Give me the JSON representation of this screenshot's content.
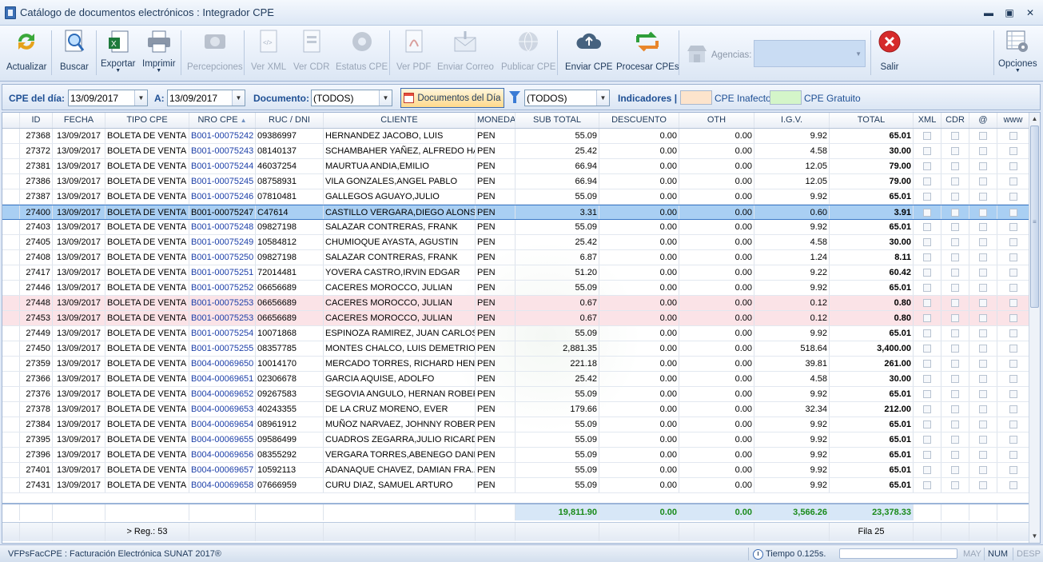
{
  "window": {
    "title": "Catálogo de documentos electrónicos : Integrador CPE"
  },
  "toolbar": {
    "actualizar": "Actualizar",
    "buscar": "Buscar",
    "exportar": "Exportar",
    "imprimir": "Imprimir",
    "percepciones": "Percepciones",
    "ver_xml": "Ver XML",
    "ver_cdr": "Ver CDR",
    "estatus_cpe": "Estatus CPE",
    "ver_pdf": "Ver PDF",
    "enviar_correo": "Enviar Correo",
    "publicar_cpe": "Publicar CPE",
    "enviar_cpe": "Enviar CPE",
    "procesar_cpes": "Procesar CPEs",
    "agencias_label": "Agencias:",
    "salir": "Salir",
    "opciones": "Opciones"
  },
  "filters": {
    "cpe_del_dia_label": "CPE del día:",
    "fecha_desde": "13/09/2017",
    "a_label": "A:",
    "fecha_hasta": "13/09/2017",
    "documento_label": "Documento:",
    "documento_value": "(TODOS)",
    "documentos_del_dia": "Documentos del Día",
    "estado_value": "(TODOS)",
    "indicadores_label": "Indicadores |",
    "inafecto_label": "CPE Inafecto",
    "gratuito_label": "CPE Gratuito",
    "inafecto_color": "#fde4cc",
    "gratuito_color": "#d4f5c9"
  },
  "grid": {
    "columns": [
      "ID",
      "FECHA",
      "TIPO CPE",
      "NRO CPE",
      "RUC / DNI",
      "CLIENTE",
      "MONEDA",
      "SUB TOTAL",
      "DESCUENTO",
      "OTH",
      "I.G.V.",
      "TOTAL",
      "XML",
      "CDR",
      "@",
      "www"
    ],
    "rows": [
      [
        "27368",
        "13/09/2017",
        "BOLETA DE VENTA",
        "B001-00075242",
        "09386997",
        "HERNANDEZ JACOBO, LUIS",
        "PEN",
        "55.09",
        "0.00",
        "0.00",
        "9.92",
        "65.01"
      ],
      [
        "27372",
        "13/09/2017",
        "BOLETA DE VENTA",
        "B001-00075243",
        "08140137",
        "SCHAMBAHER YAÑEZ, ALFREDO HANS",
        "PEN",
        "25.42",
        "0.00",
        "0.00",
        "4.58",
        "30.00"
      ],
      [
        "27381",
        "13/09/2017",
        "BOLETA DE VENTA",
        "B001-00075244",
        "46037254",
        "MAURTUA ANDIA,EMILIO",
        "PEN",
        "66.94",
        "0.00",
        "0.00",
        "12.05",
        "79.00"
      ],
      [
        "27386",
        "13/09/2017",
        "BOLETA DE VENTA",
        "B001-00075245",
        "08758931",
        "VILA GONZALES,ANGEL PABLO",
        "PEN",
        "66.94",
        "0.00",
        "0.00",
        "12.05",
        "79.00"
      ],
      [
        "27387",
        "13/09/2017",
        "BOLETA DE VENTA",
        "B001-00075246",
        "07810481",
        "GALLEGOS AGUAYO,JULIO",
        "PEN",
        "55.09",
        "0.00",
        "0.00",
        "9.92",
        "65.01"
      ],
      [
        "27400",
        "13/09/2017",
        "BOLETA DE VENTA",
        "B001-00075247",
        "C47614",
        "CASTILLO VERGARA,DIEGO ALONSO",
        "PEN",
        "3.31",
        "0.00",
        "0.00",
        "0.60",
        "3.91"
      ],
      [
        "27403",
        "13/09/2017",
        "BOLETA DE VENTA",
        "B001-00075248",
        "09827198",
        "SALAZAR CONTRERAS, FRANK",
        "PEN",
        "55.09",
        "0.00",
        "0.00",
        "9.92",
        "65.01"
      ],
      [
        "27405",
        "13/09/2017",
        "BOLETA DE VENTA",
        "B001-00075249",
        "10584812",
        "CHUMIOQUE AYASTA, AGUSTIN",
        "PEN",
        "25.42",
        "0.00",
        "0.00",
        "4.58",
        "30.00"
      ],
      [
        "27408",
        "13/09/2017",
        "BOLETA DE VENTA",
        "B001-00075250",
        "09827198",
        "SALAZAR CONTRERAS, FRANK",
        "PEN",
        "6.87",
        "0.00",
        "0.00",
        "1.24",
        "8.11"
      ],
      [
        "27417",
        "13/09/2017",
        "BOLETA DE VENTA",
        "B001-00075251",
        "72014481",
        "YOVERA CASTRO,IRVIN EDGAR",
        "PEN",
        "51.20",
        "0.00",
        "0.00",
        "9.22",
        "60.42"
      ],
      [
        "27446",
        "13/09/2017",
        "BOLETA DE VENTA",
        "B001-00075252",
        "06656689",
        "CACERES MOROCCO, JULIAN",
        "PEN",
        "55.09",
        "0.00",
        "0.00",
        "9.92",
        "65.01"
      ],
      [
        "27448",
        "13/09/2017",
        "BOLETA DE VENTA",
        "B001-00075253",
        "06656689",
        "CACERES MOROCCO, JULIAN",
        "PEN",
        "0.67",
        "0.00",
        "0.00",
        "0.12",
        "0.80"
      ],
      [
        "27453",
        "13/09/2017",
        "BOLETA DE VENTA",
        "B001-00075253",
        "06656689",
        "CACERES MOROCCO, JULIAN",
        "PEN",
        "0.67",
        "0.00",
        "0.00",
        "0.12",
        "0.80"
      ],
      [
        "27449",
        "13/09/2017",
        "BOLETA DE VENTA",
        "B001-00075254",
        "10071868",
        "ESPINOZA RAMIREZ, JUAN CARLOS",
        "PEN",
        "55.09",
        "0.00",
        "0.00",
        "9.92",
        "65.01"
      ],
      [
        "27450",
        "13/09/2017",
        "BOLETA DE VENTA",
        "B001-00075255",
        "08357785",
        "MONTES CHALCO, LUIS DEMETRIO",
        "PEN",
        "2,881.35",
        "0.00",
        "0.00",
        "518.64",
        "3,400.00"
      ],
      [
        "27359",
        "13/09/2017",
        "BOLETA DE VENTA",
        "B004-00069650",
        "10014170",
        "MERCADO TORRES, RICHARD HENRY",
        "PEN",
        "221.18",
        "0.00",
        "0.00",
        "39.81",
        "261.00"
      ],
      [
        "27366",
        "13/09/2017",
        "BOLETA DE VENTA",
        "B004-00069651",
        "02306678",
        "GARCIA AQUISE, ADOLFO",
        "PEN",
        "25.42",
        "0.00",
        "0.00",
        "4.58",
        "30.00"
      ],
      [
        "27376",
        "13/09/2017",
        "BOLETA DE VENTA",
        "B004-00069652",
        "09267583",
        "SEGOVIA ANGULO, HERNAN ROBER...",
        "PEN",
        "55.09",
        "0.00",
        "0.00",
        "9.92",
        "65.01"
      ],
      [
        "27378",
        "13/09/2017",
        "BOLETA DE VENTA",
        "B004-00069653",
        "40243355",
        "DE LA CRUZ MORENO, EVER",
        "PEN",
        "179.66",
        "0.00",
        "0.00",
        "32.34",
        "212.00"
      ],
      [
        "27384",
        "13/09/2017",
        "BOLETA DE VENTA",
        "B004-00069654",
        "08961912",
        "MUÑOZ NARVAEZ, JOHNNY ROBERT",
        "PEN",
        "55.09",
        "0.00",
        "0.00",
        "9.92",
        "65.01"
      ],
      [
        "27395",
        "13/09/2017",
        "BOLETA DE VENTA",
        "B004-00069655",
        "09586499",
        "CUADROS ZEGARRA,JULIO RICARDO",
        "PEN",
        "55.09",
        "0.00",
        "0.00",
        "9.92",
        "65.01"
      ],
      [
        "27396",
        "13/09/2017",
        "BOLETA DE VENTA",
        "B004-00069656",
        "08355292",
        "VERGARA TORRES,ABENEGO DANIEL",
        "PEN",
        "55.09",
        "0.00",
        "0.00",
        "9.92",
        "65.01"
      ],
      [
        "27401",
        "13/09/2017",
        "BOLETA DE VENTA",
        "B004-00069657",
        "10592113",
        "ADANAQUE CHAVEZ, DAMIAN FRA...",
        "PEN",
        "55.09",
        "0.00",
        "0.00",
        "9.92",
        "65.01"
      ],
      [
        "27431",
        "13/09/2017",
        "BOLETA DE VENTA",
        "B004-00069658",
        "07666959",
        "CURU DIAZ, SAMUEL ARTURO",
        "PEN",
        "55.09",
        "0.00",
        "0.00",
        "9.92",
        "65.01"
      ]
    ],
    "selected_row_id": "27400",
    "highlight_row_ids": [
      "27448",
      "27453"
    ],
    "highlight_color": "#fbe3e7",
    "totals": {
      "sub_total": "19,811.90",
      "descuento": "0.00",
      "oth": "0.00",
      "igv": "3,566.26",
      "total": "23,378.33"
    },
    "footer": {
      "reg_count": "> Reg.: 53",
      "fila": "Fila 25"
    }
  },
  "status": {
    "app": "VFPsFacCPE : Facturación Electrónica SUNAT 2017®",
    "tiempo": "Tiempo 0.125s.",
    "may": "MAY",
    "num": "NUM",
    "desp": "DESP"
  }
}
